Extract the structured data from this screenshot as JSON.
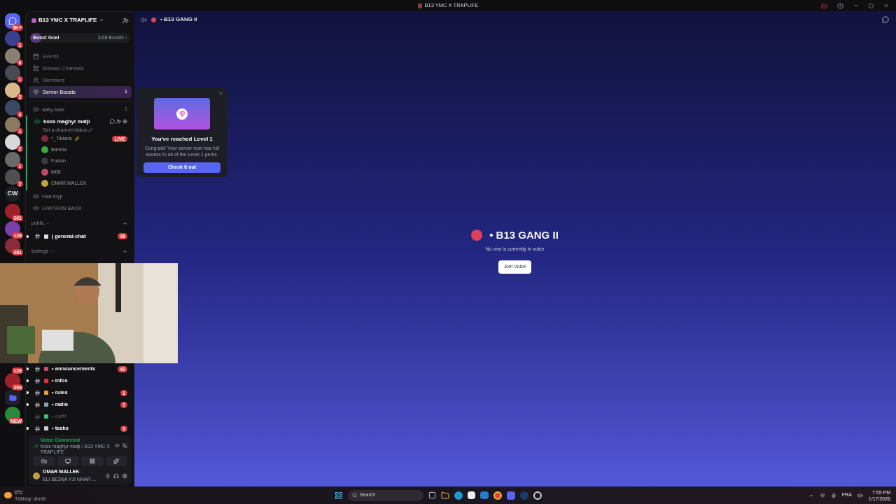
{
  "window": {
    "title": "B13 YMC X TRAPLIFE"
  },
  "servers_top": [
    {
      "kind": "logo",
      "badge": "5K+"
    },
    {
      "kind": "avatar",
      "badge": "1"
    },
    {
      "kind": "avatar",
      "badge": "6"
    },
    {
      "kind": "avatar",
      "badge": "1"
    },
    {
      "kind": "avatar",
      "badge": "2"
    },
    {
      "kind": "avatar",
      "badge": "3"
    },
    {
      "kind": "avatar",
      "badge": "1"
    },
    {
      "kind": "avatar",
      "badge": "2"
    },
    {
      "kind": "avatar",
      "badge": "1"
    },
    {
      "kind": "avatar",
      "badge": "2"
    },
    {
      "kind": "text",
      "label": "CW"
    },
    {
      "kind": "avatar",
      "badge": "261"
    },
    {
      "kind": "avatar",
      "badge": "126"
    },
    {
      "kind": "avatar",
      "badge": "281"
    }
  ],
  "servers_bottom": [
    {
      "kind": "covered",
      "badge": "126"
    },
    {
      "kind": "avatar",
      "badge": "204"
    },
    {
      "kind": "folder"
    },
    {
      "kind": "avatar",
      "badge": "NEW"
    }
  ],
  "server": {
    "name": "B13 YMC X TRAPLIFE",
    "boost_goal": {
      "label": "Boost Goal",
      "count": "3/28 Boosts ›",
      "level": 0.11
    }
  },
  "menu": [
    {
      "kind": "events",
      "label": "Events",
      "selected": false
    },
    {
      "kind": "browse",
      "label": "Browse Channels",
      "selected": false
    },
    {
      "kind": "members",
      "label": "Members",
      "selected": false
    },
    {
      "kind": "boosts",
      "label": "Server Boosts",
      "selected": true,
      "badge": "1"
    }
  ],
  "channels_top": [
    {
      "kind": "voice",
      "name": "daily-task",
      "count": "1",
      "connected": false
    },
    {
      "kind": "voice",
      "name": "boss maghyr matji",
      "status": "Set a channel status",
      "connected": true,
      "members": [
        {
          "name": "^_Tatiana",
          "badge": "LIVE",
          "color": "#7a2a3a"
        },
        {
          "name": "Bamba",
          "color": "#3aa83a"
        },
        {
          "name": "Fusion",
          "color": "#3a3a3a"
        },
        {
          "name": "M06",
          "color": "#c04a6a"
        },
        {
          "name": "OMAR MALLEK",
          "color": "#c0a040"
        }
      ]
    },
    {
      "kind": "voice",
      "name": "Had myji",
      "connected": false
    },
    {
      "kind": "voice",
      "name": "LPATRON BACK",
      "connected": false
    },
    {
      "kind": "category",
      "name": "public"
    },
    {
      "kind": "text",
      "name": "| general-chat",
      "unread": true,
      "badge": "26"
    },
    {
      "kind": "category",
      "name": "testings"
    }
  ],
  "channels_bottom": [
    {
      "kind": "text",
      "name": "• announcements",
      "unread": true,
      "badge": "42"
    },
    {
      "kind": "text",
      "name": "• infos",
      "unread": true
    },
    {
      "kind": "text",
      "name": "• rules",
      "unread": true,
      "badge": "1"
    },
    {
      "kind": "text",
      "name": "• radio",
      "unread": true,
      "badge": "7"
    },
    {
      "kind": "text",
      "name": "• outfit",
      "unread": false
    },
    {
      "kind": "text",
      "name": "• tasks",
      "unread": true,
      "badge": "3"
    }
  ],
  "voice_panel": {
    "title": "Voice Connected",
    "subtitle": "boss maghyr matji / B13 YMC X TRAPLIFE"
  },
  "user": {
    "name": "OMAR MALLEK",
    "status": "ELI BE3NA YJI NHAR ..."
  },
  "header": {
    "title": "• B13 GANG II"
  },
  "popup": {
    "title": "You've reached Level 1",
    "text": "Congrats! Your server now has full access to all of the Level 1 perks.",
    "button": "Check it out"
  },
  "center": {
    "title": "• B13 GANG II",
    "subtitle": "No one is currently in voice",
    "button": "Join Voice"
  },
  "taskbar": {
    "weather_temp": "0°C",
    "weather_text": "Többny. derült",
    "search": "Search",
    "language": "FRA",
    "time": "7:55 PM",
    "date": "1/17/2026"
  }
}
